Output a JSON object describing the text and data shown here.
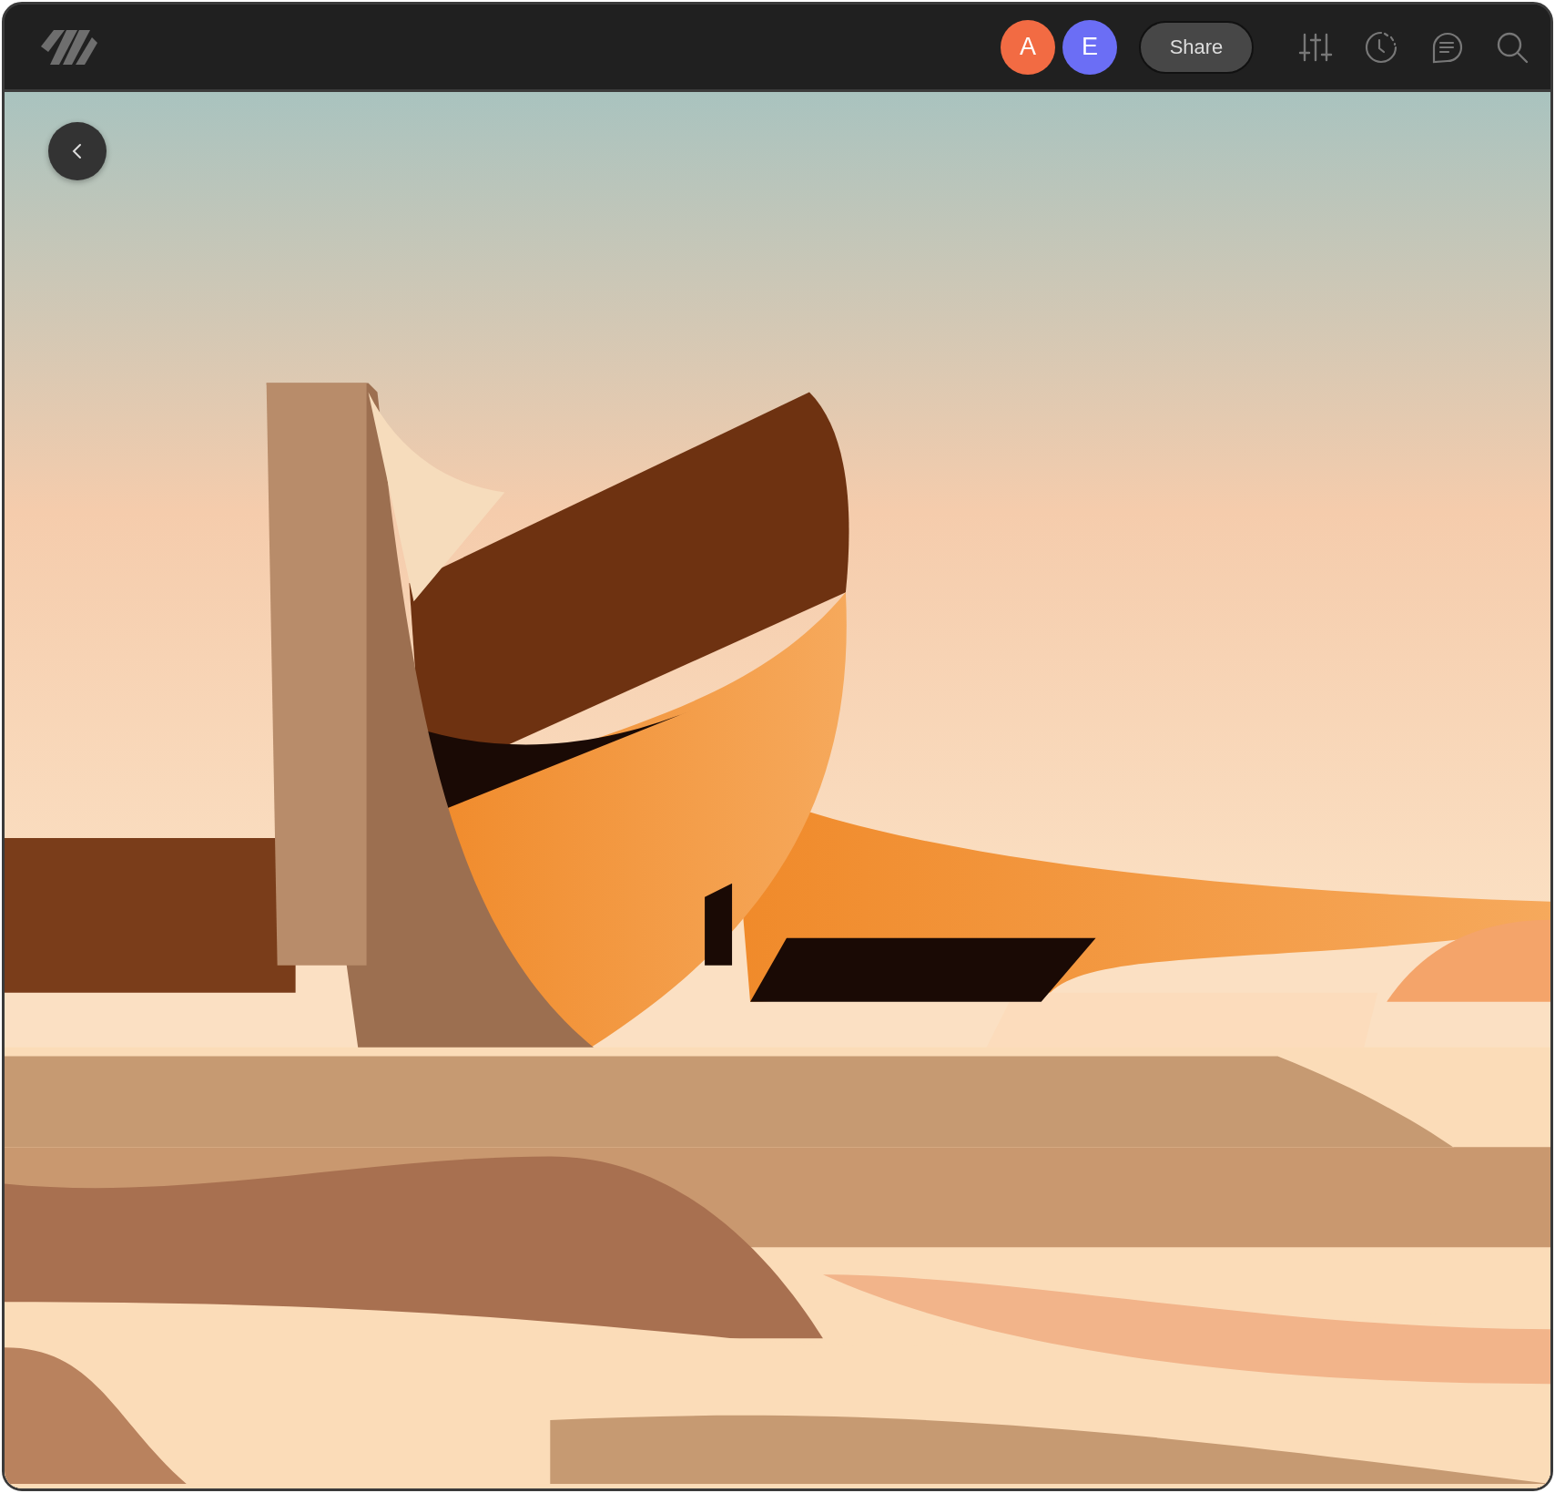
{
  "topbar": {
    "avatars": [
      {
        "initial": "A",
        "color": "#f26b43"
      },
      {
        "initial": "E",
        "color": "#6b6ef5"
      }
    ],
    "share_button": "Share"
  }
}
